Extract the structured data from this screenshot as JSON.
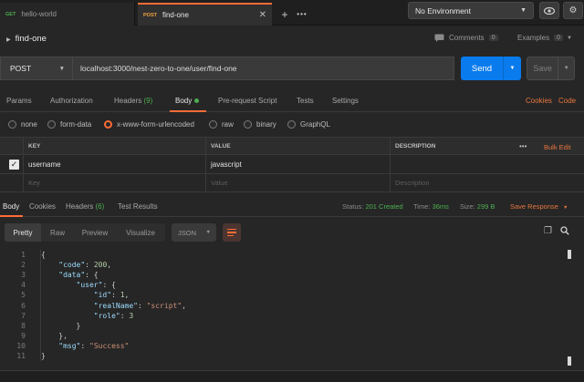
{
  "tabs": [
    {
      "method": "GET",
      "name": "hello-world"
    },
    {
      "method": "POST",
      "name": "find-one"
    }
  ],
  "tab_actions": {
    "add": "+",
    "more": "•••"
  },
  "environment": {
    "selected": "No Environment"
  },
  "request": {
    "name": "find-one",
    "comments_label": "Comments",
    "comments_count": "0",
    "examples_label": "Examples",
    "examples_count": "0",
    "method": "POST",
    "url": "localhost:3000/nest-zero-to-one/user/find-one",
    "send_label": "Send",
    "save_label": "Save"
  },
  "request_tabs": {
    "params": "Params",
    "authorization": "Authorization",
    "headers": "Headers",
    "headers_count": "(9)",
    "body": "Body",
    "pre_request": "Pre-request Script",
    "tests": "Tests",
    "settings": "Settings",
    "cookies": "Cookies",
    "code": "Code"
  },
  "body_types": [
    "none",
    "form-data",
    "x-www-form-urlencoded",
    "raw",
    "binary",
    "GraphQL"
  ],
  "body_type_selected": "x-www-form-urlencoded",
  "kv_table": {
    "headers": {
      "key": "KEY",
      "value": "VALUE",
      "description": "DESCRIPTION"
    },
    "bulk_edit": "Bulk Edit",
    "more": "•••",
    "rows": [
      {
        "key": "username",
        "value": "javascript",
        "description": ""
      }
    ],
    "placeholder": {
      "key": "Key",
      "value": "Value",
      "description": "Description"
    }
  },
  "response_tabs": {
    "body": "Body",
    "cookies": "Cookies",
    "headers": "Headers",
    "headers_count": "(6)",
    "test_results": "Test Results"
  },
  "response_meta": {
    "status_label": "Status:",
    "status_value": "201 Created",
    "time_label": "Time:",
    "time_value": "36ms",
    "size_label": "Size:",
    "size_value": "299 B",
    "save_response": "Save Response"
  },
  "response_formats": [
    "Pretty",
    "Raw",
    "Preview",
    "Visualize"
  ],
  "response_format_selected": "Pretty",
  "response_language": "JSON",
  "code_lines": [
    "{",
    "    \"code\": 200,",
    "    \"data\": {",
    "        \"user\": {",
    "            \"id\": 1,",
    "            \"realName\": \"script\",",
    "            \"role\": 3",
    "        }",
    "    },",
    "    \"msg\": \"Success\"",
    "}"
  ],
  "colors": {
    "accent": "#ff6c37",
    "send": "#097bed",
    "success": "#4caf50",
    "background": "#262626"
  }
}
